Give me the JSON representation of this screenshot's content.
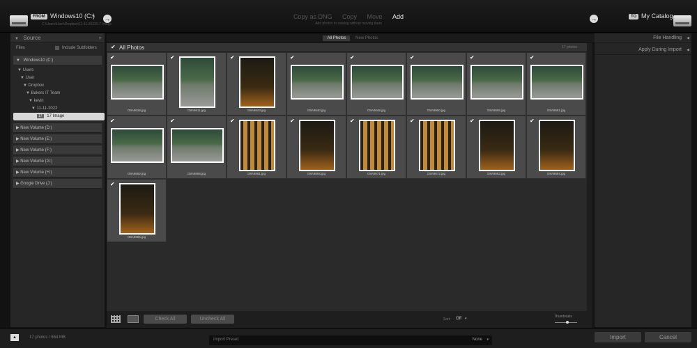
{
  "header": {
    "from_tag": "FROM",
    "source_title": "Windows10 (C:)",
    "source_path": "C:\\Users\\User\\Dropbox\\11-11-2022\\17 Image",
    "modes": [
      "Copy as DNG",
      "Copy",
      "Move",
      "Add"
    ],
    "mode_hint": "Add photos to catalog without moving them",
    "to_tag": "TO",
    "dest_title": "My Catalog"
  },
  "filter_tabs": [
    "All Photos",
    "New Photos"
  ],
  "source_panel": {
    "title": "Source",
    "files_label": "Files",
    "include_sub": "Include Subfolders",
    "drive": "Windows10 (C:)",
    "tree": [
      "Users",
      "User",
      "Dropbox",
      "Bakers IT Team",
      "kevin",
      "11-11-2022"
    ],
    "selected_folder": "17 Image",
    "selected_count": "17",
    "volumes": [
      "New Volume (D:)",
      "New Volume (E:)",
      "New Volume (F:)",
      "New Volume (G:)",
      "New Volume (H:)",
      "Google Drive (J:)"
    ]
  },
  "right_panel": {
    "file_handling": "File Handling",
    "apply_during_import": "Apply During Import"
  },
  "grid_header": {
    "title": "All Photos",
    "count": "17 photos"
  },
  "photos": [
    "O8A9628.jpg",
    "O8A9611.jpg",
    "O8A9623.jpg",
    "O8A9640.jpg",
    "O8A9648.jpg",
    "O8A9650.jpg",
    "O8A9655.jpg",
    "O8A9651.jpg",
    "O8A9652.jpg",
    "O8A9656.jpg",
    "O8A9661.jpg",
    "O8A9664.jpg",
    "O8A9671.jpg",
    "O8A9672.jpg",
    "O8A9683.jpg",
    "O8A9684.jpg",
    "O8A9685.jpg"
  ],
  "toolbar": {
    "check_all": "Check All",
    "uncheck_all": "Uncheck All",
    "sort_label": "Sort:",
    "sort_value": "Off",
    "thumbnails_label": "Thumbnails"
  },
  "footer": {
    "status": "17 photos / 664 MB",
    "import_preset_label": "Import Preset:",
    "import_preset_value": "None",
    "import_button": "Import",
    "cancel_button": "Cancel"
  },
  "colors": {
    "panel": "#262626",
    "cell": "#4a4a4a",
    "background": "#121212"
  }
}
